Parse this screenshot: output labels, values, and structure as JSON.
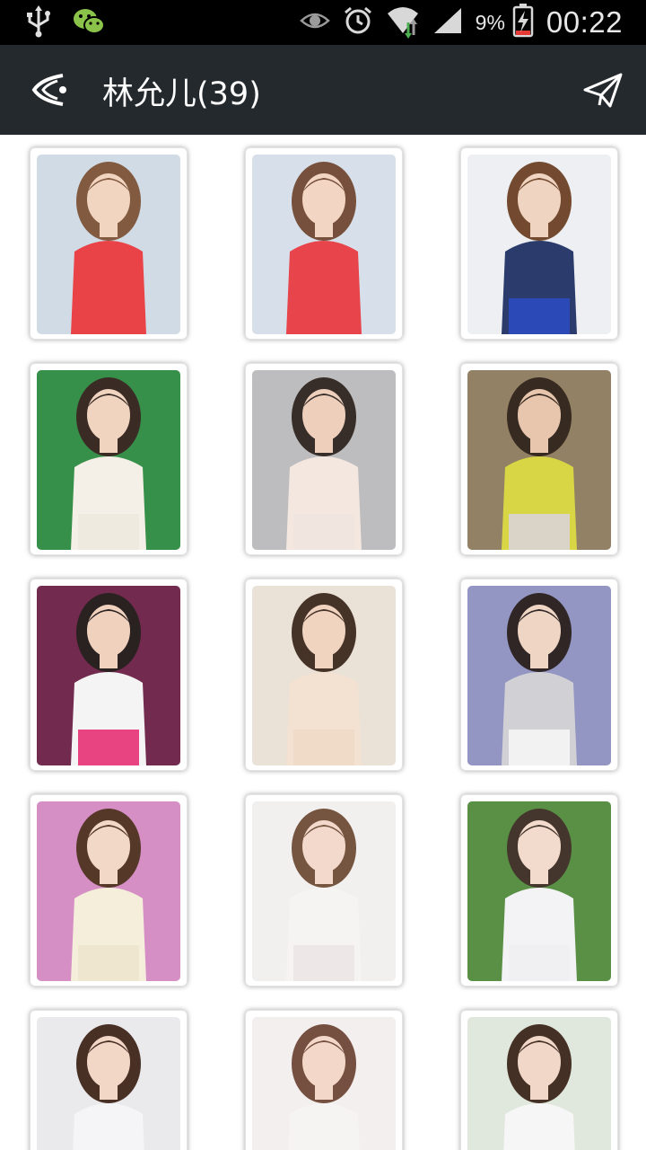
{
  "status_bar": {
    "battery_percent": "9%",
    "time": "00:22",
    "icons": [
      "usb-icon",
      "wechat-icon",
      "eye-icon",
      "alarm-icon",
      "wifi-icon",
      "signal-icon",
      "battery-charging-icon"
    ]
  },
  "header": {
    "title": "林允儿(39)",
    "back_icon": "back-arrow-icon",
    "share_icon": "send-icon"
  },
  "gallery": {
    "photos": [
      {
        "bg": "#cfd9e4",
        "top": "#e8383d",
        "bottom": "#e8383d",
        "skin": "#f1d3bd",
        "hair": "#7a5035"
      },
      {
        "bg": "#d5dfe9",
        "top": "#e63a40",
        "bottom": "#e63a40",
        "skin": "#f2d4c0",
        "hair": "#6e4630"
      },
      {
        "bg": "#eceff2",
        "top": "#1d2f63",
        "bottom": "#1f3fb3",
        "skin": "#eed2bf",
        "hair": "#6b3f22"
      },
      {
        "bg": "#2b8a3e",
        "top": "#f4f0e6",
        "bottom": "#efe9df",
        "skin": "#f0d2bd",
        "hair": "#2e1f18"
      },
      {
        "bg": "#b9b9bb",
        "top": "#f3e6df",
        "bottom": "#f1e5de",
        "skin": "#ecccb8",
        "hair": "#2b201c"
      },
      {
        "bg": "#8d7a5c",
        "top": "#d6d43a",
        "bottom": "#d8d2c5",
        "skin": "#e7c3a8",
        "hair": "#2a1d14"
      },
      {
        "bg": "#6a1d45",
        "top": "#f4f4f4",
        "bottom": "#e6397a",
        "skin": "#f0cfba",
        "hair": "#1d1414"
      },
      {
        "bg": "#e9e1d4",
        "top": "#f3e0cf",
        "bottom": "#f0d9c6",
        "skin": "#f1d2bd",
        "hair": "#3b271b"
      },
      {
        "bg": "#8d8fc0",
        "top": "#cfcfd3",
        "bottom": "#f2f2f2",
        "skin": "#efd3c1",
        "hair": "#231918"
      },
      {
        "bg": "#d489c2",
        "top": "#f4edd8",
        "bottom": "#efe5cc",
        "skin": "#f2d6c4",
        "hair": "#4c2c1c"
      },
      {
        "bg": "#f2eeee",
        "top": "#f6f3f3",
        "bottom": "#ece6e6",
        "skin": "#f3d7c8",
        "hair": "#6d4b35"
      },
      {
        "bg": "#4f8a3a",
        "top": "#f3f3f5",
        "bottom": "#f0f0f2",
        "skin": "#f2d9c9",
        "hair": "#3a2a20"
      },
      {
        "bg": "#e9e9ec",
        "top": "#f5f5f7",
        "bottom": "#f2f2f4",
        "skin": "#f2d4c3",
        "hair": "#3e2418"
      },
      {
        "bg": "#f3eeee",
        "top": "#f6f3f3",
        "bottom": "#ece6e6",
        "skin": "#f3d6c6",
        "hair": "#6d4535"
      },
      {
        "bg": "#dfe6da",
        "top": "#f6f6f6",
        "bottom": "#f0f0f0",
        "skin": "#f1d5c4",
        "hair": "#3a2419"
      }
    ]
  }
}
